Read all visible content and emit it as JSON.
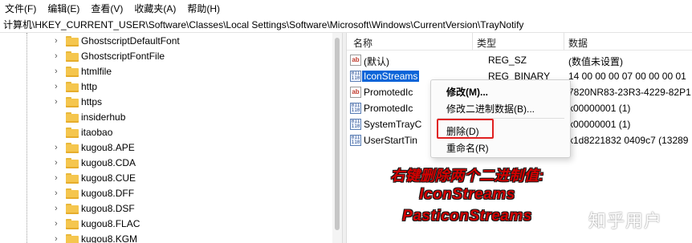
{
  "menubar": {
    "items": [
      "文件(F)",
      "编辑(E)",
      "查看(V)",
      "收藏夹(A)",
      "帮助(H)"
    ]
  },
  "address": {
    "path": "计算机\\HKEY_CURRENT_USER\\Software\\Classes\\Local Settings\\Software\\Microsoft\\Windows\\CurrentVersion\\TrayNotify"
  },
  "tree": {
    "items": [
      {
        "label": "GhostscriptDefaultFont",
        "expandable": true
      },
      {
        "label": "GhostscriptFontFile",
        "expandable": true
      },
      {
        "label": "htmlfile",
        "expandable": true
      },
      {
        "label": "http",
        "expandable": true
      },
      {
        "label": "https",
        "expandable": true
      },
      {
        "label": "insiderhub",
        "expandable": false
      },
      {
        "label": "itaobao",
        "expandable": false
      },
      {
        "label": "kugou8.APE",
        "expandable": true
      },
      {
        "label": "kugou8.CDA",
        "expandable": true
      },
      {
        "label": "kugou8.CUE",
        "expandable": true
      },
      {
        "label": "kugou8.DFF",
        "expandable": true
      },
      {
        "label": "kugou8.DSF",
        "expandable": true
      },
      {
        "label": "kugou8.FLAC",
        "expandable": true
      },
      {
        "label": "kugou8.KGM",
        "expandable": true
      }
    ]
  },
  "values": {
    "headers": {
      "name": "名称",
      "type": "类型",
      "data": "数据"
    },
    "rows": [
      {
        "icon": "string-value-icon",
        "name": "(默认)",
        "type": "REG_SZ",
        "data": "(数值未设置)",
        "selected": false
      },
      {
        "icon": "binary-value-icon",
        "name": "IconStreams",
        "type": "REG_BINARY",
        "data": "14 00 00 00 07 00 00 00 01",
        "selected": true
      },
      {
        "icon": "string-value-icon",
        "name": "PromotedIc",
        "type": "",
        "data": "7820NR83-23R3-4229-82P1",
        "selected": false
      },
      {
        "icon": "binary-value-icon",
        "name": "PromotedIc",
        "type": "",
        "data": "x00000001 (1)",
        "selected": false
      },
      {
        "icon": "binary-value-icon",
        "name": "SystemTrayC",
        "type": "",
        "data": "x00000001 (1)",
        "selected": false
      },
      {
        "icon": "binary-value-icon",
        "name": "UserStartTin",
        "type": "",
        "data": "x1d8221832 0409c7 (13289",
        "selected": false
      }
    ]
  },
  "context_menu": {
    "items": [
      {
        "label": "修改(M)...",
        "bold": true
      },
      {
        "label": "修改二进制数据(B)...",
        "bold": false
      },
      {
        "label": "删除(D)",
        "bold": false,
        "highlighted": true
      },
      {
        "label": "重命名(R)",
        "bold": false
      }
    ]
  },
  "annotation": {
    "line1": "右键删除两个二进制值:",
    "line2": "IconStreams",
    "line3": "PasticonStreams"
  },
  "watermark": "知乎用户",
  "colors": {
    "selection": "#0a64d8",
    "highlight_border": "#e02020",
    "annotation_text": "#d40000",
    "folder": "#f5c64e"
  }
}
